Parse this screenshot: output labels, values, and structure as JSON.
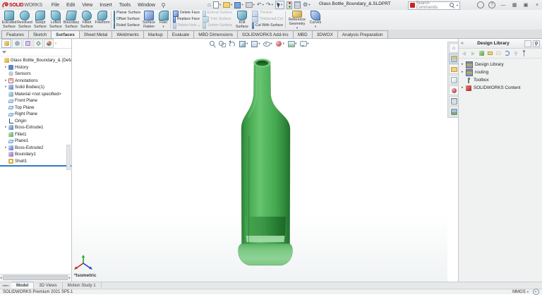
{
  "title_bar": {
    "logo_bold": "SOLID",
    "logo_light": "WORKS",
    "menus": [
      "File",
      "Edit",
      "View",
      "Insert",
      "Tools",
      "Window"
    ],
    "document_title": "Glass Bottle_Boundary_&.SLDPRT",
    "search_placeholder": "Search Commands",
    "quick_access_icons": [
      "home",
      "new-file",
      "open-file",
      "save",
      "print",
      "undo",
      "redo",
      "select-cursor",
      "rebuild",
      "file-properties",
      "options-gear"
    ],
    "window_control_icons": [
      "account",
      "help",
      "minimize",
      "tile-windows",
      "restore",
      "close"
    ]
  },
  "ribbon": {
    "tabs": [
      {
        "label": "Features",
        "active": false
      },
      {
        "label": "Sketch",
        "active": false
      },
      {
        "label": "Surfaces",
        "active": true
      },
      {
        "label": "Sheet Metal",
        "active": false
      },
      {
        "label": "Weldments",
        "active": false
      },
      {
        "label": "Markup",
        "active": false
      },
      {
        "label": "Evaluate",
        "active": false
      },
      {
        "label": "MBD Dimensions",
        "active": false
      },
      {
        "label": "SOLIDWORKS Add-Ins",
        "active": false
      },
      {
        "label": "MBD",
        "active": false
      },
      {
        "label": "3DWOX",
        "active": false
      },
      {
        "label": "Analysis Preparation",
        "active": false
      }
    ],
    "large_left": [
      "Extruded Surface",
      "Revolved Surface",
      "Swept Surface",
      "Lofted Surface",
      "Boundary Surface",
      "Filled Surface",
      "Freeform"
    ],
    "stack_planar": [
      "Planar Surface",
      "Offset Surface",
      "Ruled Surface"
    ],
    "large_mid": [
      "Surface Flatten",
      "Fillet"
    ],
    "stack_face": [
      {
        "label": "Delete Face",
        "enabled": true
      },
      {
        "label": "Replace Face",
        "enabled": true
      },
      {
        "label": "Delete Hole",
        "enabled": false
      }
    ],
    "stack_trim": [
      {
        "label": "Extend Surface",
        "enabled": false
      },
      {
        "label": "Trim Surface",
        "enabled": false
      },
      {
        "label": "Untrim Surface",
        "enabled": false
      }
    ],
    "knit_label": "Knit Surface",
    "stack_thicken": [
      {
        "label": "Thicken",
        "enabled": false
      },
      {
        "label": "Thickened Cut",
        "enabled": false
      },
      {
        "label": "Cut With Surface",
        "enabled": true
      }
    ],
    "large_right": [
      "Reference Geometry",
      "Curves"
    ]
  },
  "feature_tree": {
    "panel_tab_icons": [
      "featuremanager",
      "propertymanager",
      "configurationmanager",
      "dimxpertmanager",
      "displaymanager"
    ],
    "items": [
      {
        "label": "Glass Bottle_Boundary_&  (Default<<Def",
        "icon": "part",
        "expandable": false
      },
      {
        "label": "History",
        "icon": "history-folder",
        "expandable": true
      },
      {
        "label": "Sensors",
        "icon": "sensors",
        "expandable": false
      },
      {
        "label": "Annotations",
        "icon": "annotations",
        "expandable": true
      },
      {
        "label": "Solid Bodies(1)",
        "icon": "solid-bodies-folder",
        "expandable": true
      },
      {
        "label": "Material <not specified>",
        "icon": "material",
        "expandable": false
      },
      {
        "label": "Front Plane",
        "icon": "plane",
        "expandable": false
      },
      {
        "label": "Top Plane",
        "icon": "plane",
        "expandable": false
      },
      {
        "label": "Right Plane",
        "icon": "plane",
        "expandable": false
      },
      {
        "label": "Origin",
        "icon": "origin",
        "expandable": false
      },
      {
        "label": "Boss-Extrude1",
        "icon": "boss-extrude",
        "expandable": true
      },
      {
        "label": "Fillet1",
        "icon": "fillet",
        "expandable": false
      },
      {
        "label": "Plane1",
        "icon": "plane",
        "expandable": false
      },
      {
        "label": "Boss-Extrude2",
        "icon": "boss-extrude",
        "expandable": true
      },
      {
        "label": "Boundary1",
        "icon": "boundary",
        "expandable": false
      },
      {
        "label": "Shell1",
        "icon": "shell",
        "expandable": false
      }
    ]
  },
  "viewport": {
    "view_label": "*Isometric",
    "headsup_icons": [
      "zoom-to-fit",
      "zoom-to-area",
      "previous-view",
      "section-view",
      "display-style",
      "hide-show-items",
      "edit-appearance",
      "apply-scene",
      "view-settings"
    ],
    "model": {
      "name": "green glass bottle",
      "body_color": "#46a951",
      "edge_dark": "#226f2b",
      "highlight": "#6cc573",
      "base_color": "#84cc8b"
    },
    "triad_axis_colors": {
      "x": "#cc2222",
      "y": "#22aa22",
      "z": "#2244cc"
    }
  },
  "task_pane": {
    "title": "Design Library",
    "toolbar_icons": [
      "back",
      "forward",
      "add-to-library",
      "create-new-folder",
      "file-location",
      "refresh",
      "move-up",
      "toolbox-config"
    ],
    "items": [
      {
        "label": "Design Library",
        "icon": "design-library-folder",
        "expandable": true
      },
      {
        "label": "routing",
        "icon": "design-library-folder",
        "expandable": true
      },
      {
        "label": "Toolbox",
        "icon": "toolbox-bolt",
        "expandable": false
      },
      {
        "label": "SOLIDWORKS Content",
        "icon": "solidworks-content",
        "expandable": true
      }
    ],
    "side_tab_icons": [
      "home",
      "design-library",
      "file-explorer",
      "view-palette",
      "appearances-scenes",
      "custom-properties",
      "solidworks-resources"
    ]
  },
  "bottom_tabs": [
    {
      "label": "Model",
      "active": true
    },
    {
      "label": "3D Views",
      "active": false
    },
    {
      "label": "Motion Study 1",
      "active": false
    }
  ],
  "status_bar": {
    "left_text": "SOLIDWORKS Premium 2021 SP5.1",
    "units": "MMGS"
  }
}
